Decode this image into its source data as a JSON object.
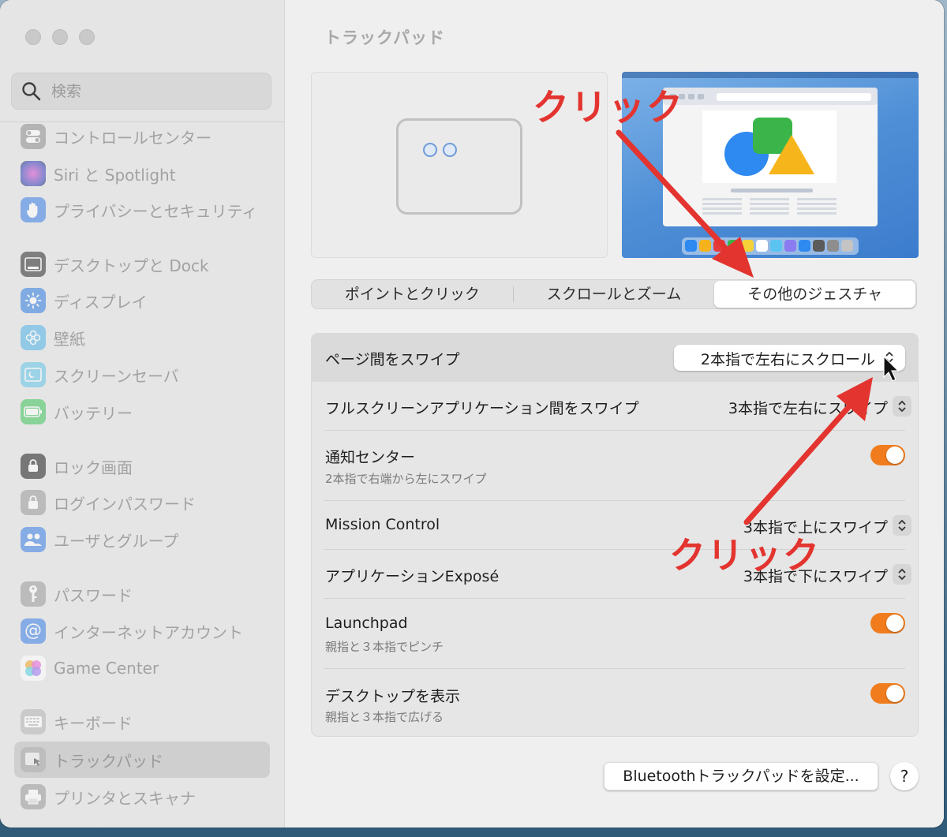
{
  "window": {
    "title": "トラックパッド"
  },
  "sidebar": {
    "search_placeholder": "検索",
    "items": [
      {
        "label": "コントロールセンター",
        "icon": "control-center-icon"
      },
      {
        "label": "Siri と Spotlight",
        "icon": "siri-icon"
      },
      {
        "label": "プライバシーとセキュリティ",
        "icon": "privacy-hand-icon"
      },
      {
        "label": "デスクトップと Dock",
        "icon": "desktop-dock-icon"
      },
      {
        "label": "ディスプレイ",
        "icon": "display-sun-icon"
      },
      {
        "label": "壁紙",
        "icon": "wallpaper-flower-icon"
      },
      {
        "label": "スクリーンセーバ",
        "icon": "screensaver-icon"
      },
      {
        "label": "バッテリー",
        "icon": "battery-icon"
      },
      {
        "label": "ロック画面",
        "icon": "lock-screen-icon"
      },
      {
        "label": "ログインパスワード",
        "icon": "login-lock-icon"
      },
      {
        "label": "ユーザとグループ",
        "icon": "users-groups-icon"
      },
      {
        "label": "パスワード",
        "icon": "key-icon"
      },
      {
        "label": "インターネットアカウント",
        "icon": "at-sign-icon"
      },
      {
        "label": "Game Center",
        "icon": "game-center-icon"
      },
      {
        "label": "キーボード",
        "icon": "keyboard-icon"
      },
      {
        "label": "トラックパッド",
        "icon": "trackpad-icon",
        "selected": true
      },
      {
        "label": "プリンタとスキャナ",
        "icon": "printer-icon"
      }
    ]
  },
  "tabs": {
    "point_click": "ポイントとクリック",
    "scroll_zoom": "スクロールとズーム",
    "more_gestures": "その他のジェスチャ",
    "active": "more_gestures"
  },
  "settings": {
    "swipe_pages": {
      "label": "ページ間をスワイプ",
      "value": "2本指で左右にスクロール"
    },
    "swipe_fullscreen": {
      "label": "フルスクリーンアプリケーション間をスワイプ",
      "value": "3本指で左右にスワイプ"
    },
    "notification_center": {
      "label": "通知センター",
      "sub": "2本指で右端から左にスワイプ",
      "on": true
    },
    "mission_control": {
      "label": "Mission Control",
      "value": "3本指で上にスワイプ"
    },
    "app_expose": {
      "label": "アプリケーションExposé",
      "value": "3本指で下にスワイプ"
    },
    "launchpad": {
      "label": "Launchpad",
      "sub": "親指と３本指でピンチ",
      "on": true
    },
    "show_desktop": {
      "label": "デスクトップを表示",
      "sub": "親指と３本指で広げる",
      "on": true
    }
  },
  "footer": {
    "bluetooth_button": "Bluetoothトラックパッドを設定...",
    "help": "?"
  },
  "annotations": {
    "top_label": "クリック",
    "bottom_label": "クリック",
    "color": "#e3342f"
  },
  "colors": {
    "toggle_on": "#f07c1d",
    "accent_blue": "#3c7ccd"
  }
}
